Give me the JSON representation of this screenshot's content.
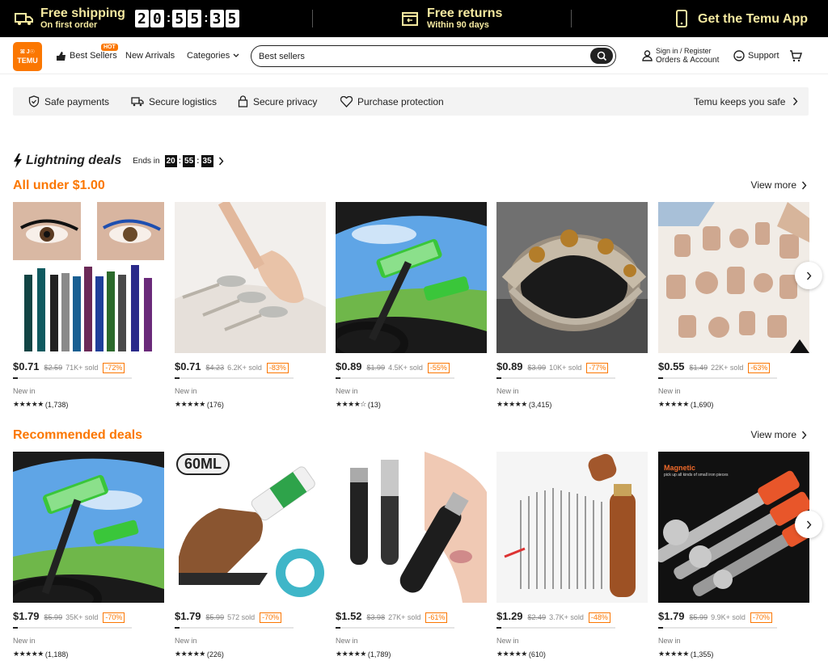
{
  "promo": {
    "shipping_title": "Free shipping",
    "shipping_sub": "On first order",
    "countdown": [
      "2",
      "0",
      "5",
      "5",
      "3",
      "5"
    ],
    "returns_title": "Free returns",
    "returns_sub": "Within 90 days",
    "app_label": "Get the Temu App"
  },
  "header": {
    "logo_top": "ꕤ J☉",
    "logo_text": "TEMU",
    "nav_best": "Best Sellers",
    "hot_badge": "HOT",
    "nav_new": "New Arrivals",
    "nav_categories": "Categories",
    "search_value": "Best sellers",
    "signin_top": "Sign in / Register",
    "signin_bottom": "Orders & Account",
    "support": "Support"
  },
  "trust": {
    "payments": "Safe payments",
    "logistics": "Secure logistics",
    "privacy": "Secure privacy",
    "protection": "Purchase protection",
    "safe": "Temu keeps you safe"
  },
  "lightning": {
    "title": "Lightning deals",
    "ends_in": "Ends in",
    "hh": "20",
    "mm": "55",
    "ss": "35",
    "subtitle": "All under $1.00",
    "view_more": "View more",
    "products": [
      {
        "price": "$0.71",
        "old": "$2.59",
        "sold": "71K+ sold",
        "disc": "-72%",
        "tag": "New in",
        "stars": "★★★★★",
        "reviews": "(1,738)",
        "progress": 0.04
      },
      {
        "price": "$0.71",
        "old": "$4.23",
        "sold": "6.2K+ sold",
        "disc": "-83%",
        "tag": "New in",
        "stars": "★★★★★",
        "reviews": "(176)",
        "progress": 0.04
      },
      {
        "price": "$0.89",
        "old": "$1.99",
        "sold": "4.5K+ sold",
        "disc": "-55%",
        "tag": "New in",
        "stars": "★★★★☆",
        "reviews": "(13)",
        "progress": 0.04
      },
      {
        "price": "$0.89",
        "old": "$3.99",
        "sold": "10K+ sold",
        "disc": "-77%",
        "tag": "New in",
        "stars": "★★★★★",
        "reviews": "(3,415)",
        "progress": 0.04
      },
      {
        "price": "$0.55",
        "old": "$1.49",
        "sold": "22K+ sold",
        "disc": "-63%",
        "tag": "New in",
        "stars": "★★★★★",
        "reviews": "(1,690)",
        "progress": 0.04
      }
    ]
  },
  "recommended": {
    "title": "Recommended deals",
    "view_more": "View more",
    "badge_60ml": "60ML",
    "magnetic_title": "Magnetic",
    "magnetic_sub": "pick up all kinds of small iron pieces",
    "products": [
      {
        "price": "$1.79",
        "old": "$5.99",
        "sold": "35K+ sold",
        "disc": "-70%",
        "tag": "New in",
        "stars": "★★★★★",
        "reviews": "(1,188)",
        "progress": 0.04
      },
      {
        "price": "$1.79",
        "old": "$5.99",
        "sold": "572 sold",
        "disc": "-70%",
        "tag": "New in",
        "stars": "★★★★★",
        "reviews": "(226)",
        "progress": 0.04
      },
      {
        "price": "$1.52",
        "old": "$3.98",
        "sold": "27K+ sold",
        "disc": "-61%",
        "tag": "New in",
        "stars": "★★★★★",
        "reviews": "(1,789)",
        "progress": 0.04
      },
      {
        "price": "$1.29",
        "old": "$2.49",
        "sold": "3.7K+ sold",
        "disc": "-48%",
        "tag": "New in",
        "stars": "★★★★★",
        "reviews": "(610)",
        "progress": 0.04
      },
      {
        "price": "$1.79",
        "old": "$5.99",
        "sold": "9.9K+ sold",
        "disc": "-70%",
        "tag": "New in",
        "stars": "★★★★★",
        "reviews": "(1,355)",
        "progress": 0.04
      }
    ]
  },
  "colors": {
    "accent": "#fb7701",
    "promo_text": "#f5e9a0"
  }
}
